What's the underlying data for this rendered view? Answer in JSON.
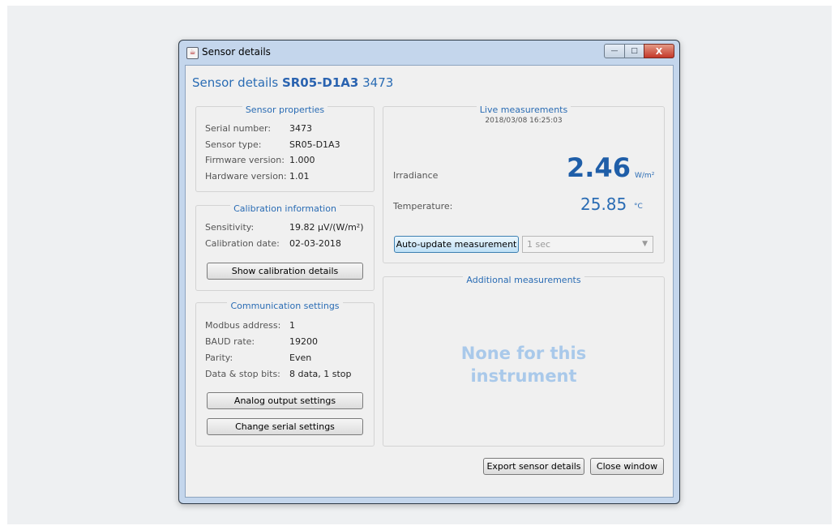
{
  "window": {
    "title": "Sensor details",
    "icon": "java-cup-icon",
    "controls": {
      "minimize": "—",
      "maximize": "□",
      "close": "X"
    }
  },
  "heading": {
    "prefix": "Sensor details",
    "model": "SR05-D1A3",
    "serial": "3473"
  },
  "sensor_properties": {
    "legend": "Sensor properties",
    "rows": [
      {
        "label": "Serial number:",
        "value": "3473"
      },
      {
        "label": "Sensor type:",
        "value": "SR05-D1A3"
      },
      {
        "label": "Firmware version:",
        "value": "1.000"
      },
      {
        "label": "Hardware version:",
        "value": "1.01"
      }
    ]
  },
  "calibration": {
    "legend": "Calibration information",
    "rows": [
      {
        "label": "Sensitivity:",
        "value": "19.82 µV/(W/m²)"
      },
      {
        "label": "Calibration date:",
        "value": "02-03-2018"
      }
    ],
    "button": "Show calibration details"
  },
  "communication": {
    "legend": "Communication settings",
    "rows": [
      {
        "label": "Modbus address:",
        "value": "1"
      },
      {
        "label": "BAUD rate:",
        "value": "19200"
      },
      {
        "label": "Parity:",
        "value": "Even"
      },
      {
        "label": "Data & stop bits:",
        "value": "8 data, 1 stop"
      }
    ],
    "analog_button": "Analog output settings",
    "serial_button": "Change serial settings"
  },
  "live": {
    "legend": "Live measurements",
    "timestamp": "2018/03/08 16:25:03",
    "irradiance_label": "Irradiance",
    "irradiance_value": "2.46",
    "irradiance_unit": "W/m²",
    "temperature_label": "Temperature:",
    "temperature_value": "25.85",
    "temperature_unit": "°C",
    "auto_update_button": "Auto-update measurement",
    "interval_selected": "1 sec"
  },
  "additional": {
    "legend": "Additional measurements",
    "message_line1": "None for this",
    "message_line2": "instrument"
  },
  "footer": {
    "export_button": "Export sensor details",
    "close_button": "Close window"
  },
  "colors": {
    "accent": "#2a6cb4",
    "value_big": "#1f5ea8",
    "placeholder": "#a9c9ea"
  }
}
